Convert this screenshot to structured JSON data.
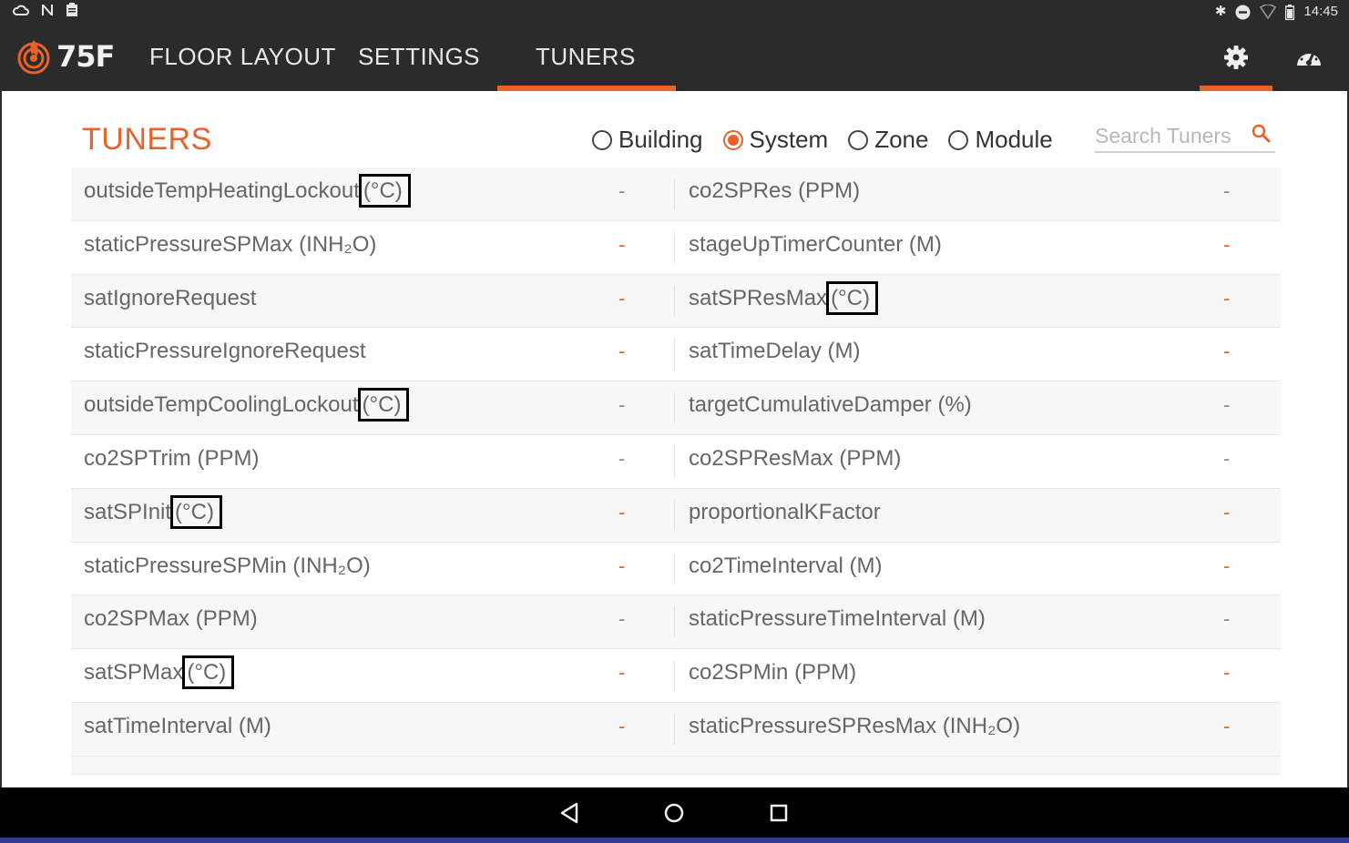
{
  "status_bar": {
    "left_icons": [
      "cloud-icon",
      "n-icon",
      "clipboard-icon"
    ],
    "right_icons": [
      "bluetooth-icon",
      "minus-circle-icon",
      "wifi-icon",
      "battery-icon"
    ],
    "time": "14:45"
  },
  "app": {
    "logo_text": "75F",
    "nav_tabs": [
      {
        "label": "FLOOR LAYOUT",
        "active": false
      },
      {
        "label": "SETTINGS",
        "active": false
      },
      {
        "label": "TUNERS",
        "active": true
      }
    ],
    "accent_color": "#e8622a",
    "bar_color": "#2b2b2b"
  },
  "page": {
    "title": "TUNERS",
    "scope_options": [
      {
        "label": "Building",
        "checked": false
      },
      {
        "label": "System",
        "checked": true
      },
      {
        "label": "Zone",
        "checked": false
      },
      {
        "label": "Module",
        "checked": false
      }
    ],
    "search": {
      "placeholder": "Search Tuners",
      "value": ""
    }
  },
  "tuners": [
    {
      "left": {
        "name": "outsideTempHeatingLockout",
        "unit": "(°C)",
        "value": "-"
      },
      "right": {
        "name": "co2SPRes",
        "unit": "(PPM)",
        "value": "-"
      }
    },
    {
      "left": {
        "name": "staticPressureSPMax",
        "unit": "(INH₂O)",
        "value": "-"
      },
      "right": {
        "name": "stageUpTimerCounter",
        "unit": "(M)",
        "value": "-"
      }
    },
    {
      "left": {
        "name": "satIgnoreRequest",
        "unit": "",
        "value": "-"
      },
      "right": {
        "name": "satSPResMax",
        "unit": "(°C)",
        "value": "-"
      }
    },
    {
      "left": {
        "name": "staticPressureIgnoreRequest",
        "unit": "",
        "value": "-"
      },
      "right": {
        "name": "satTimeDelay",
        "unit": "(M)",
        "value": "-"
      }
    },
    {
      "left": {
        "name": "outsideTempCoolingLockout",
        "unit": "(°C)",
        "value": "-"
      },
      "right": {
        "name": "targetCumulativeDamper",
        "unit": "(%)",
        "value": "-"
      }
    },
    {
      "left": {
        "name": "co2SPTrim",
        "unit": "(PPM)",
        "value": "-"
      },
      "right": {
        "name": "co2SPResMax",
        "unit": "(PPM)",
        "value": "-"
      }
    },
    {
      "left": {
        "name": "satSPInit",
        "unit": "(°C)",
        "value": "-"
      },
      "right": {
        "name": "proportionalKFactor",
        "unit": "",
        "value": "-"
      }
    },
    {
      "left": {
        "name": "staticPressureSPMin",
        "unit": "(INH₂O)",
        "value": "-"
      },
      "right": {
        "name": "co2TimeInterval",
        "unit": "(M)",
        "value": "-"
      }
    },
    {
      "left": {
        "name": "co2SPMax",
        "unit": "(PPM)",
        "value": "-"
      },
      "right": {
        "name": "staticPressureTimeInterval",
        "unit": "(M)",
        "value": "-"
      }
    },
    {
      "left": {
        "name": "satSPMax",
        "unit": "(°C)",
        "value": "-"
      },
      "right": {
        "name": "co2SPMin",
        "unit": "(PPM)",
        "value": "-"
      }
    },
    {
      "left": {
        "name": "satTimeInterval",
        "unit": "(M)",
        "value": "-"
      },
      "right": {
        "name": "staticPressureSPResMax",
        "unit": "(INH₂O)",
        "value": "-"
      }
    }
  ],
  "system_nav": [
    "back-icon",
    "home-icon",
    "recents-icon"
  ]
}
